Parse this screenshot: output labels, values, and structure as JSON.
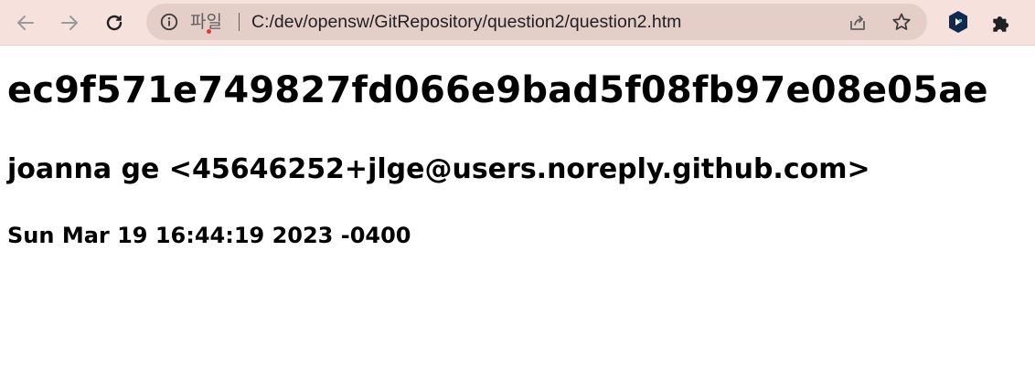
{
  "browser": {
    "scheme_label": "파일",
    "url": "C:/dev/opensw/GitRepository/question2/question2.htm",
    "icons": {
      "back": "arrow-left-icon",
      "forward": "arrow-right-icon",
      "reload": "reload-icon",
      "info": "info-icon",
      "share": "share-icon",
      "bookmark": "star-icon",
      "extension": "extension-icon",
      "extensions_menu": "puzzle-icon"
    },
    "toolbar_color": "#f6e1dc",
    "omnibox_color": "#e6cec8"
  },
  "page": {
    "commit_hash": "ec9f571e749827fd066e9bad5f08fb97e08e05ae",
    "author": "joanna ge <45646252+jlge@users.noreply.github.com>",
    "date": "Sun Mar 19 16:44:19 2023 -0400"
  }
}
